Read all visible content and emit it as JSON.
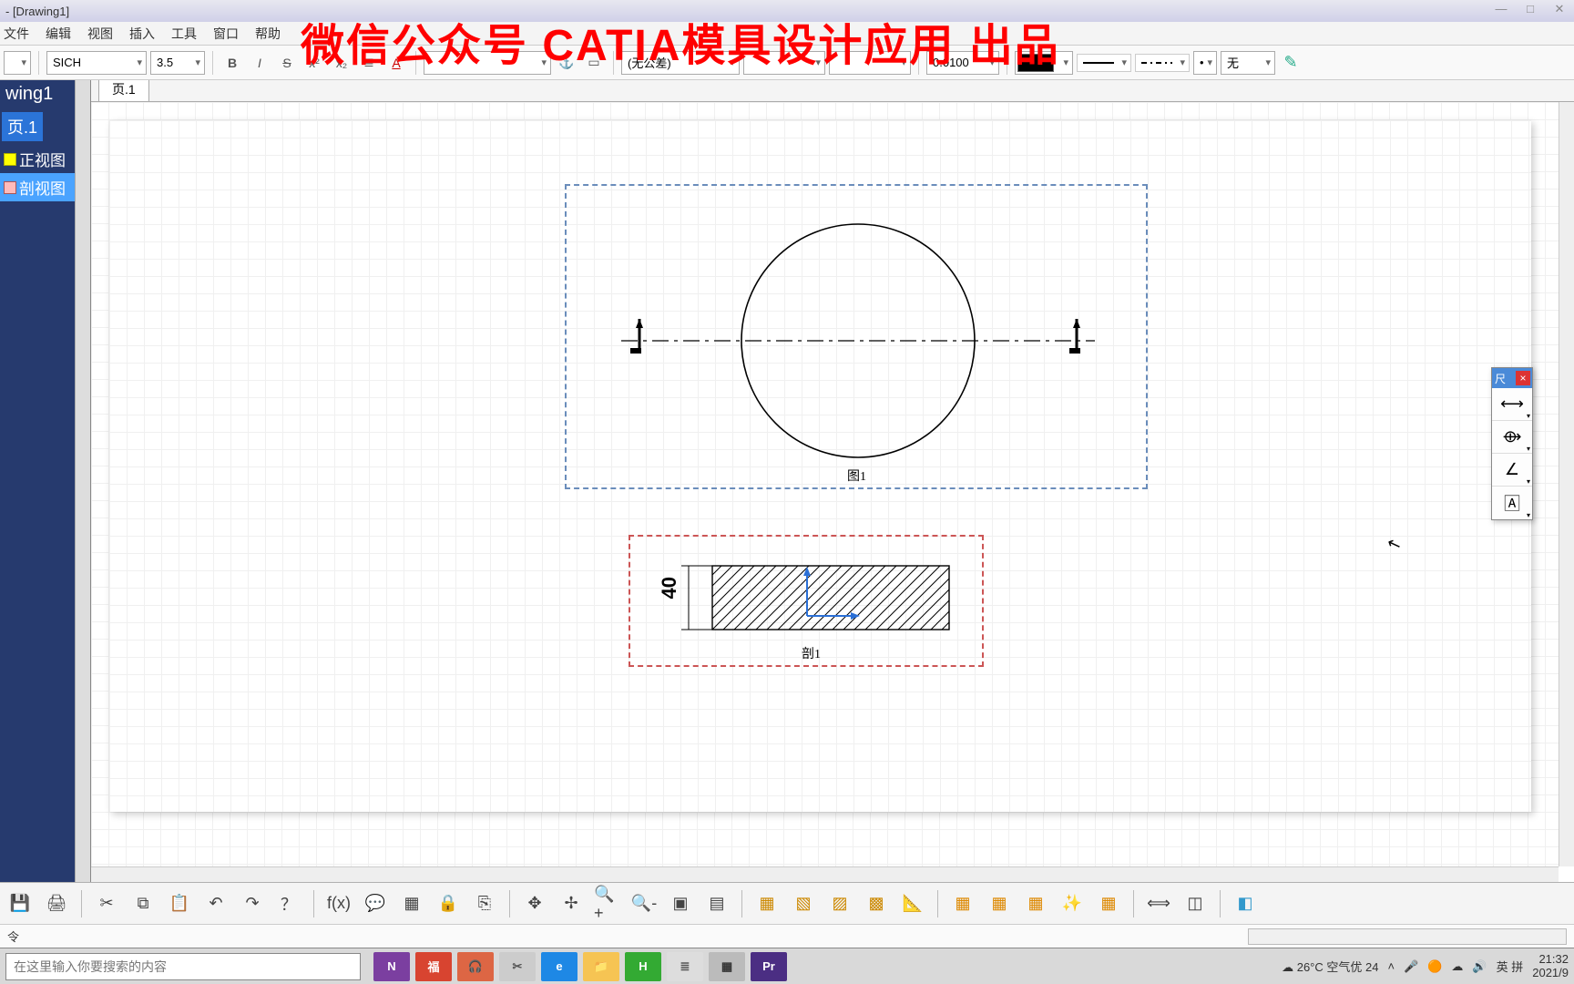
{
  "title": "- [Drawing1]",
  "watermark": "微信公众号 CATIA模具设计应用 出品",
  "menu": {
    "items": [
      "文件",
      "编辑",
      "视图",
      "插入",
      "工具",
      "窗口",
      "帮助"
    ]
  },
  "toolbar": {
    "font_family": "SICH",
    "font_size": "3.5",
    "tolerance_mode": "(无公差)",
    "numeric_step": "0.0100",
    "line_end": "无",
    "bold": "B",
    "italic": "I",
    "strike": "S"
  },
  "tree": {
    "title": "wing1",
    "page": "页.1",
    "views": [
      {
        "label": "正视图",
        "selected": false
      },
      {
        "label": "剖视图",
        "selected": true
      }
    ]
  },
  "tab": {
    "label": "页.1"
  },
  "drawing": {
    "dim_value": "40",
    "view1_label": "图1",
    "view2_label": "剖1"
  },
  "float_palette": {
    "title_btn": "尺"
  },
  "statusbar": {
    "hint": "令"
  },
  "taskbar": {
    "search_placeholder": "在这里输入你要搜索的内容",
    "weather": "26°C 空气优 24",
    "ime": "英 拼",
    "time": "21:32",
    "date": "2021/9"
  }
}
